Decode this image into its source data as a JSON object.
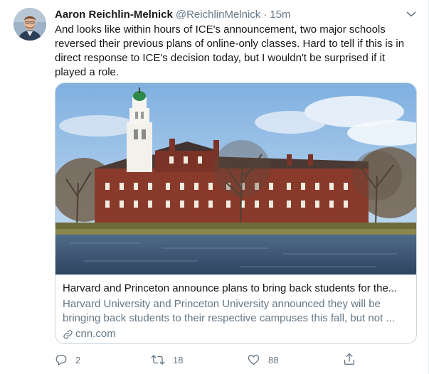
{
  "tweet": {
    "author_name": "Aaron Reichlin-Melnick",
    "handle": "@ReichlinMelnick",
    "separator": "·",
    "time": "15m",
    "text": "And looks like within hours of ICE's announcement, two major schools reversed their previous plans of online-only classes. Hard to tell if this is in direct response to ICE's decision today, but I wouldn't be surprised if it played a role."
  },
  "card": {
    "title": "Harvard and Princeton announce plans to bring back students for the...",
    "description": "Harvard University and Princeton University announced they will be bringing back students to their respective campuses this fall, but not ...",
    "domain": "cnn.com"
  },
  "actions": {
    "reply_count": "2",
    "retweet_count": "18",
    "like_count": "88"
  },
  "icons": {
    "caret": "chevron-down-icon",
    "link": "link-icon",
    "reply": "reply-icon",
    "retweet": "retweet-icon",
    "like": "heart-icon",
    "share": "share-icon"
  },
  "colors": {
    "text_primary": "#14171a",
    "text_secondary": "#657786",
    "border": "#ccd6dd"
  }
}
